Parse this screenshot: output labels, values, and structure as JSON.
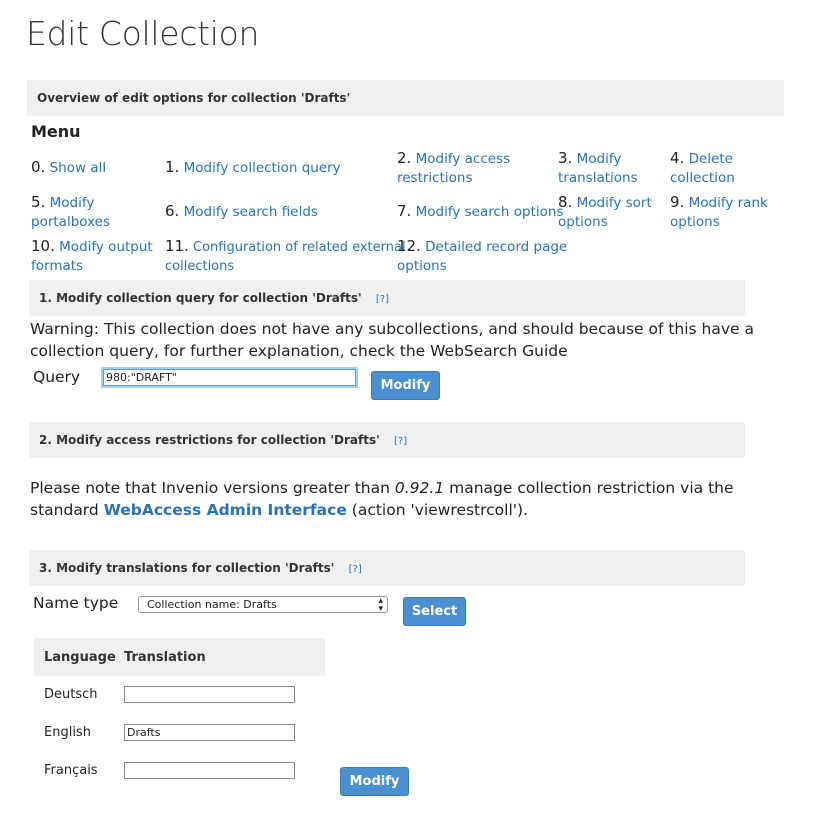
{
  "page_title": "Edit Collection",
  "overview_bar": "Overview of edit options for collection 'Drafts'",
  "menu": {
    "title": "Menu",
    "items": [
      {
        "num": "0.",
        "label": "Show all"
      },
      {
        "num": "1.",
        "label": "Modify collection query"
      },
      {
        "num": "2.",
        "label": "Modify access",
        "label2": "restrictions"
      },
      {
        "num": "3.",
        "label": "Modify",
        "label2": "translations"
      },
      {
        "num": "4.",
        "label": "Delete",
        "label2": "collection"
      },
      {
        "num": "5.",
        "label": "Modify",
        "label2": "portalboxes"
      },
      {
        "num": "6.",
        "label": "Modify search fields"
      },
      {
        "num": "7.",
        "label": "Modify search options"
      },
      {
        "num": "8.",
        "label": "Modify sort",
        "label2": "options"
      },
      {
        "num": "9.",
        "label": "Modify rank",
        "label2": "options"
      },
      {
        "num": "10.",
        "label": "Modify output",
        "label2": "formats"
      },
      {
        "num": "11.",
        "label": "Configuration of related external",
        "label2": "collections"
      },
      {
        "num": "12.",
        "label": "Detailed record page",
        "label2": "options"
      }
    ]
  },
  "section1": {
    "title": "1. Modify collection query for collection 'Drafts'",
    "help": "[?]",
    "warning_line1": "Warning: This collection does not have any subcollections, and should because of this have a",
    "warning_line2": "collection query, for further explanation, check the WebSearch Guide",
    "query_label": "Query",
    "query_value": "980:\"DRAFT\"",
    "button": "Modify"
  },
  "section2": {
    "title": "2. Modify access restrictions for collection 'Drafts'",
    "help": "[?]",
    "note_part1": "Please note that Invenio versions greater than ",
    "note_version": "0.92.1",
    "note_part2": " manage collection restriction via the",
    "note_part3": "standard ",
    "note_link": "WebAccess Admin Interface",
    "note_part4": " (action 'viewrestrcoll')."
  },
  "section3": {
    "title": "3. Modify translations for collection 'Drafts'",
    "help": "[?]",
    "name_type_label": "Name type",
    "name_type_selected": "Collection name: Drafts",
    "select_button": "Select",
    "table_headers": [
      "Language",
      "Translation"
    ],
    "rows": [
      {
        "language": "Deutsch",
        "value": ""
      },
      {
        "language": "English",
        "value": "Drafts"
      },
      {
        "language": "Français",
        "value": ""
      }
    ],
    "modify_button": "Modify"
  }
}
